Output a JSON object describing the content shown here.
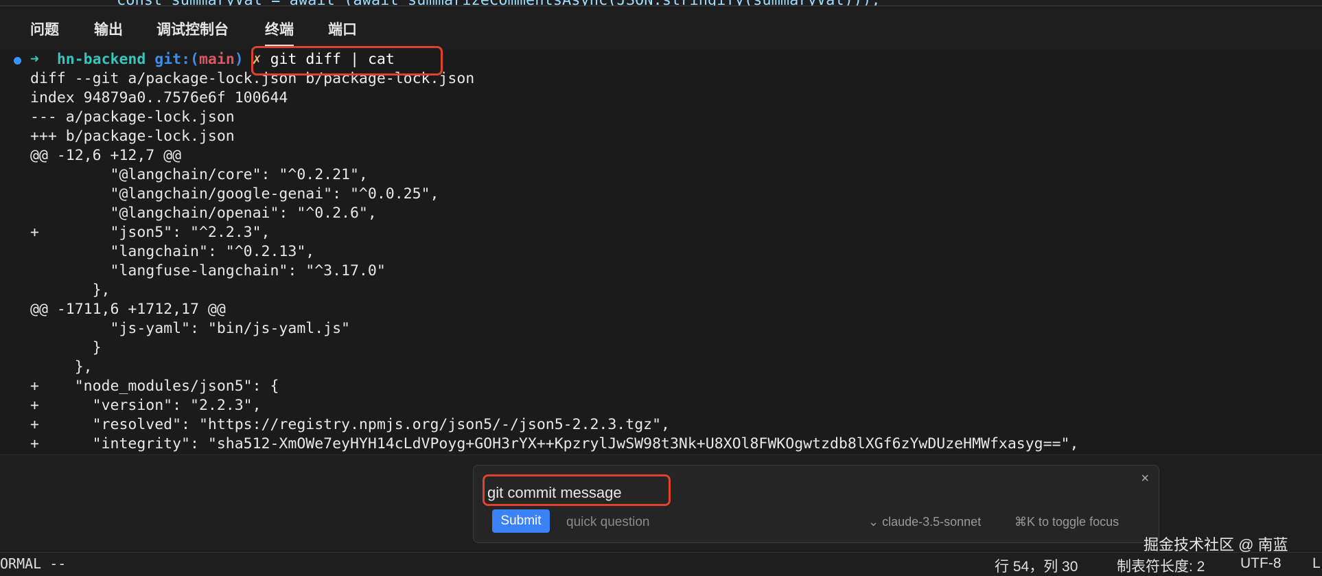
{
  "editor_peek": "const summaryVal = await (await summarizeCommentsAsync(JSON.stringify(summaryVal)));",
  "panel": {
    "tabs": [
      {
        "label": "问题"
      },
      {
        "label": "输出"
      },
      {
        "label": "调试控制台"
      },
      {
        "label": "终端",
        "active": true
      },
      {
        "label": "端口"
      }
    ]
  },
  "terminal": {
    "prompt": {
      "arrow": "➜",
      "dir": "hn-backend",
      "git": "git:(",
      "branch": "main",
      "git_close": ")",
      "dirty": "✗",
      "command": "git diff | cat"
    },
    "lines": [
      {
        "marker": "",
        "text": "diff --git a/package-lock.json b/package-lock.json"
      },
      {
        "marker": "",
        "text": "index 94879a0..7576e6f 100644"
      },
      {
        "marker": "",
        "text": "--- a/package-lock.json"
      },
      {
        "marker": "",
        "text": "+++ b/package-lock.json"
      },
      {
        "marker": "",
        "text": "@@ -12,6 +12,7 @@"
      },
      {
        "marker": "",
        "text": "         \"@langchain/core\": \"^0.2.21\","
      },
      {
        "marker": "",
        "text": "         \"@langchain/google-genai\": \"^0.0.25\","
      },
      {
        "marker": "",
        "text": "         \"@langchain/openai\": \"^0.2.6\","
      },
      {
        "marker": "+",
        "text": "         \"json5\": \"^2.2.3\","
      },
      {
        "marker": "",
        "text": "         \"langchain\": \"^0.2.13\","
      },
      {
        "marker": "",
        "text": "         \"langfuse-langchain\": \"^3.17.0\""
      },
      {
        "marker": "",
        "text": "       },"
      },
      {
        "marker": "",
        "text": "@@ -1711,6 +1712,17 @@"
      },
      {
        "marker": "",
        "text": "         \"js-yaml\": \"bin/js-yaml.js\""
      },
      {
        "marker": "",
        "text": "       }"
      },
      {
        "marker": "",
        "text": "     },"
      },
      {
        "marker": "+",
        "text": "     \"node_modules/json5\": {"
      },
      {
        "marker": "+",
        "text": "       \"version\": \"2.2.3\","
      },
      {
        "marker": "+",
        "text": "       \"resolved\": \"https://registry.npmjs.org/json5/-/json5-2.2.3.tgz\","
      },
      {
        "marker": "+",
        "text": "       \"integrity\": \"sha512-XmOWe7eyHYH14cLdVPoyg+GOH3rYX++KpzrylJwSW98t3Nk+U8XOl8FWKOgwtzdb8lXGf6zYwDUzeHMWfxasyg==\","
      }
    ]
  },
  "chat": {
    "input_value": "git commit message",
    "submit_label": "Submit",
    "quick_question": "quick question",
    "model": "claude-3.5-sonnet",
    "toggle_hint": "⌘K to toggle focus",
    "close_icon": "×"
  },
  "watermark": "掘金技术社区 @ 南蓝",
  "status": {
    "mode": "ORMAL --",
    "position": "行 54，列 30",
    "tab_size": "制表符长度: 2",
    "encoding": "UTF-8",
    "eol": "L"
  },
  "colors": {
    "highlight": "#e0422f",
    "submit": "#3b82f6",
    "prompt_dot": "#3794ff"
  }
}
